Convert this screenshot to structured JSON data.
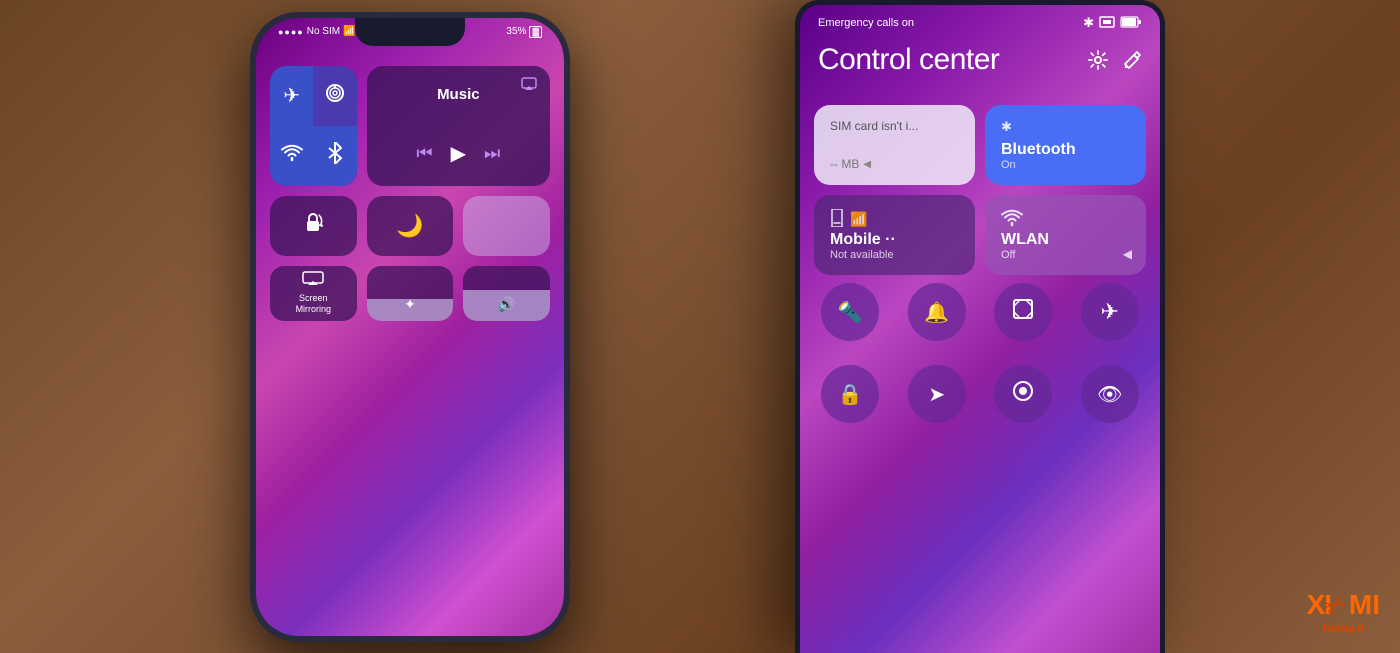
{
  "background": {
    "color": "#6b4423"
  },
  "iphone": {
    "status": {
      "carrier": "No SIM",
      "wifi_icon": "wifi",
      "battery": "35%"
    },
    "control_center": {
      "music_label": "Music",
      "screen_mirroring_label": "Screen\nMirroring",
      "buttons": {
        "airplane": "✈",
        "cellular": "📶",
        "wifi": "wifi",
        "bluetooth": "bluetooth"
      }
    }
  },
  "xiaomi": {
    "status": {
      "emergency": "Emergency calls on",
      "bluetooth_icon": "bluetooth",
      "sim_icon": "sim",
      "battery_icon": "battery"
    },
    "title": "Control center",
    "tiles": {
      "sim": {
        "label": "SIM card isn't i...",
        "sub": "-- MB"
      },
      "bluetooth": {
        "label": "Bluetooth",
        "sub": "On"
      },
      "mobile": {
        "label": "Mobile ·· ",
        "sub": "Not available"
      },
      "wlan": {
        "label": "WLAN",
        "sub": "Off"
      }
    },
    "icons_row1": [
      "flashlight",
      "bell",
      "screenshot",
      "airplane"
    ],
    "icons_row2": [
      "lock",
      "navigation",
      "privacy",
      "eye"
    ]
  },
  "watermark": {
    "brand": "XIAOMI",
    "domain": "today.it"
  }
}
